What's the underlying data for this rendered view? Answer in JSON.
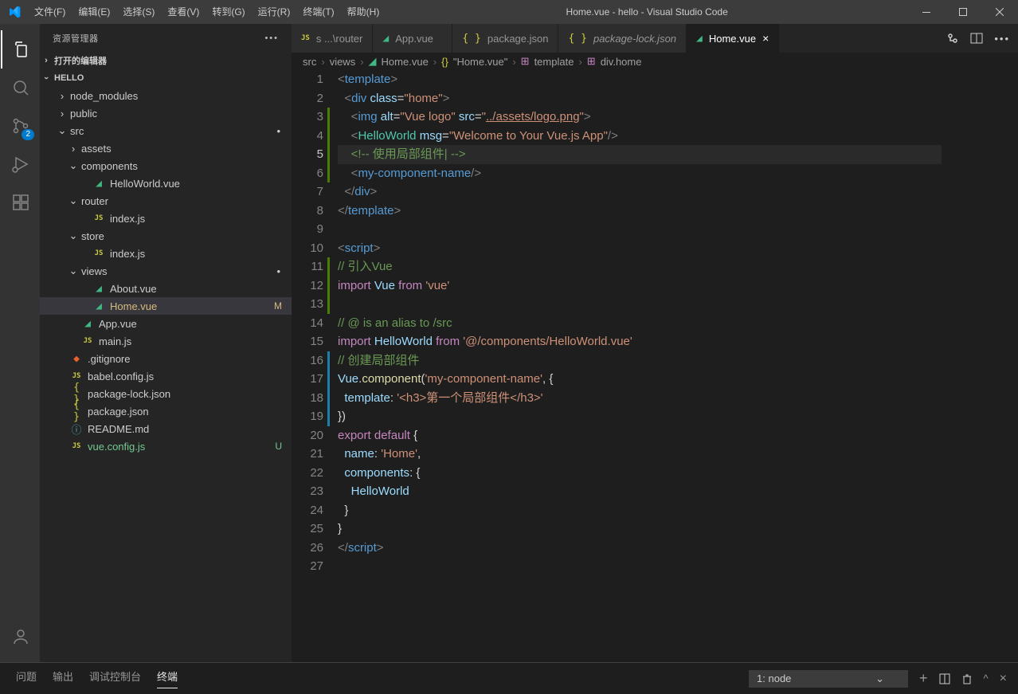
{
  "titlebar": {
    "menus": [
      "文件(F)",
      "编辑(E)",
      "选择(S)",
      "查看(V)",
      "转到(G)",
      "运行(R)",
      "终端(T)",
      "帮助(H)"
    ],
    "title": "Home.vue - hello - Visual Studio Code"
  },
  "activitybar": {
    "scm_badge": "2"
  },
  "sidebar": {
    "title": "资源管理器",
    "open_editors": "打开的编辑器",
    "folder": "HELLO",
    "tree": [
      {
        "d": 1,
        "type": "folder",
        "open": false,
        "label": "node_modules"
      },
      {
        "d": 1,
        "type": "folder",
        "open": false,
        "label": "public"
      },
      {
        "d": 1,
        "type": "folder",
        "open": true,
        "label": "src",
        "dot": true
      },
      {
        "d": 2,
        "type": "folder",
        "open": false,
        "label": "assets"
      },
      {
        "d": 2,
        "type": "folder",
        "open": true,
        "label": "components"
      },
      {
        "d": 3,
        "type": "file",
        "icon": "vue",
        "label": "HelloWorld.vue"
      },
      {
        "d": 2,
        "type": "folder",
        "open": true,
        "label": "router"
      },
      {
        "d": 3,
        "type": "file",
        "icon": "js",
        "label": "index.js"
      },
      {
        "d": 2,
        "type": "folder",
        "open": true,
        "label": "store"
      },
      {
        "d": 3,
        "type": "file",
        "icon": "js",
        "label": "index.js"
      },
      {
        "d": 2,
        "type": "folder",
        "open": true,
        "label": "views",
        "dot": true
      },
      {
        "d": 3,
        "type": "file",
        "icon": "vue",
        "label": "About.vue"
      },
      {
        "d": 3,
        "type": "file",
        "icon": "vue",
        "label": "Home.vue",
        "selected": true,
        "status": "M",
        "statusClass": "mod"
      },
      {
        "d": 2,
        "type": "file",
        "icon": "vue",
        "label": "App.vue"
      },
      {
        "d": 2,
        "type": "file",
        "icon": "js",
        "label": "main.js"
      },
      {
        "d": 1,
        "type": "file",
        "icon": "git",
        "label": ".gitignore"
      },
      {
        "d": 1,
        "type": "file",
        "icon": "js",
        "label": "babel.config.js"
      },
      {
        "d": 1,
        "type": "file",
        "icon": "json",
        "label": "package-lock.json"
      },
      {
        "d": 1,
        "type": "file",
        "icon": "json",
        "label": "package.json"
      },
      {
        "d": 1,
        "type": "file",
        "icon": "md",
        "label": "README.md"
      },
      {
        "d": 1,
        "type": "file",
        "icon": "js",
        "label": "vue.config.js",
        "status": "U",
        "statusClass": "unt"
      }
    ]
  },
  "tabs": [
    {
      "icon": "js",
      "label": "s ...\\router",
      "partial": true
    },
    {
      "icon": "vue",
      "label": "App.vue"
    },
    {
      "icon": "json",
      "label": "package.json"
    },
    {
      "icon": "json",
      "label": "package-lock.json",
      "italic": true
    },
    {
      "icon": "vue",
      "label": "Home.vue",
      "active": true,
      "close": true
    }
  ],
  "breadcrumb": [
    "src",
    "views",
    "Home.vue",
    "\"Home.vue\"",
    "template",
    "div.home"
  ],
  "breadcrumb_icons": [
    "",
    "",
    "vue",
    "json",
    "tag",
    "tag"
  ],
  "code_lines": [
    {
      "n": 1,
      "html": "<span class='t-brk'>&lt;</span><span class='t-tag'>template</span><span class='t-brk'>&gt;</span>"
    },
    {
      "n": 2,
      "html": "  <span class='t-brk'>&lt;</span><span class='t-tag'>div</span> <span class='t-attr'>class</span>=<span class='t-str'>\"home\"</span><span class='t-brk'>&gt;</span>"
    },
    {
      "n": 3,
      "bar": "green",
      "html": "    <span class='t-brk'>&lt;</span><span class='t-tag'>img</span> <span class='t-attr'>alt</span>=<span class='t-str'>\"Vue logo\"</span> <span class='t-attr'>src</span>=<span class='t-str'>\"<u>../assets/logo.png</u>\"</span><span class='t-brk'>&gt;</span>"
    },
    {
      "n": 4,
      "bar": "green",
      "html": "    <span class='t-brk'>&lt;</span><span class='t-cls'>HelloWorld</span> <span class='t-attr'>msg</span>=<span class='t-str'>\"Welcome to Your Vue.js App\"</span><span class='t-brk'>/&gt;</span>"
    },
    {
      "n": 5,
      "bar": "green",
      "active": true,
      "html": "    <span class='t-cmt'>&lt;!-- 使用局部组件| --&gt;</span>"
    },
    {
      "n": 6,
      "bar": "green",
      "html": "    <span class='t-brk'>&lt;</span><span class='t-tag'>my-component-name</span><span class='t-brk'>/&gt;</span>"
    },
    {
      "n": 7,
      "html": "  <span class='t-brk'>&lt;/</span><span class='t-tag'>div</span><span class='t-brk'>&gt;</span>"
    },
    {
      "n": 8,
      "html": "<span class='t-brk'>&lt;/</span><span class='t-tag'>template</span><span class='t-brk'>&gt;</span>"
    },
    {
      "n": 9,
      "html": ""
    },
    {
      "n": 10,
      "html": "<span class='t-brk'>&lt;</span><span class='t-tag'>script</span><span class='t-brk'>&gt;</span>"
    },
    {
      "n": 11,
      "bar": "green",
      "html": "<span class='t-cmt'>// 引入Vue</span>"
    },
    {
      "n": 12,
      "bar": "green",
      "html": "<span class='t-kw'>import</span> <span class='t-var'>Vue</span> <span class='t-kw'>from</span> <span class='t-str'>'vue'</span>"
    },
    {
      "n": 13,
      "bar": "green",
      "html": ""
    },
    {
      "n": 14,
      "html": "<span class='t-cmt'>// @ is an alias to /src</span>"
    },
    {
      "n": 15,
      "html": "<span class='t-kw'>import</span> <span class='t-var'>HelloWorld</span> <span class='t-kw'>from</span> <span class='t-str'>'@/components/HelloWorld.vue'</span>"
    },
    {
      "n": 16,
      "bar": "blue",
      "html": "<span class='t-cmt'>// 创建局部组件</span>"
    },
    {
      "n": 17,
      "bar": "blue",
      "html": "<span class='t-var'>Vue</span>.<span class='t-fn'>component</span>(<span class='t-str'>'my-component-name'</span>, {"
    },
    {
      "n": 18,
      "bar": "blue",
      "html": "  <span class='t-prop'>template</span>: <span class='t-str'>'&lt;h3&gt;第一个局部组件&lt;/h3&gt;'</span>"
    },
    {
      "n": 19,
      "bar": "blue",
      "html": "})"
    },
    {
      "n": 20,
      "html": "<span class='t-kw'>export</span> <span class='t-kw'>default</span> {"
    },
    {
      "n": 21,
      "html": "  <span class='t-prop'>name</span>: <span class='t-str'>'Home'</span>,"
    },
    {
      "n": 22,
      "html": "  <span class='t-prop'>components</span>: {"
    },
    {
      "n": 23,
      "html": "    <span class='t-var'>HelloWorld</span>"
    },
    {
      "n": 24,
      "html": "  }"
    },
    {
      "n": 25,
      "html": "}"
    },
    {
      "n": 26,
      "html": "<span class='t-brk'>&lt;/</span><span class='t-tag'>script</span><span class='t-brk'>&gt;</span>"
    },
    {
      "n": 27,
      "html": ""
    }
  ],
  "panel": {
    "tabs": [
      "问题",
      "输出",
      "调试控制台",
      "终端"
    ],
    "active_tab": 3,
    "terminal_select": "1: node"
  }
}
